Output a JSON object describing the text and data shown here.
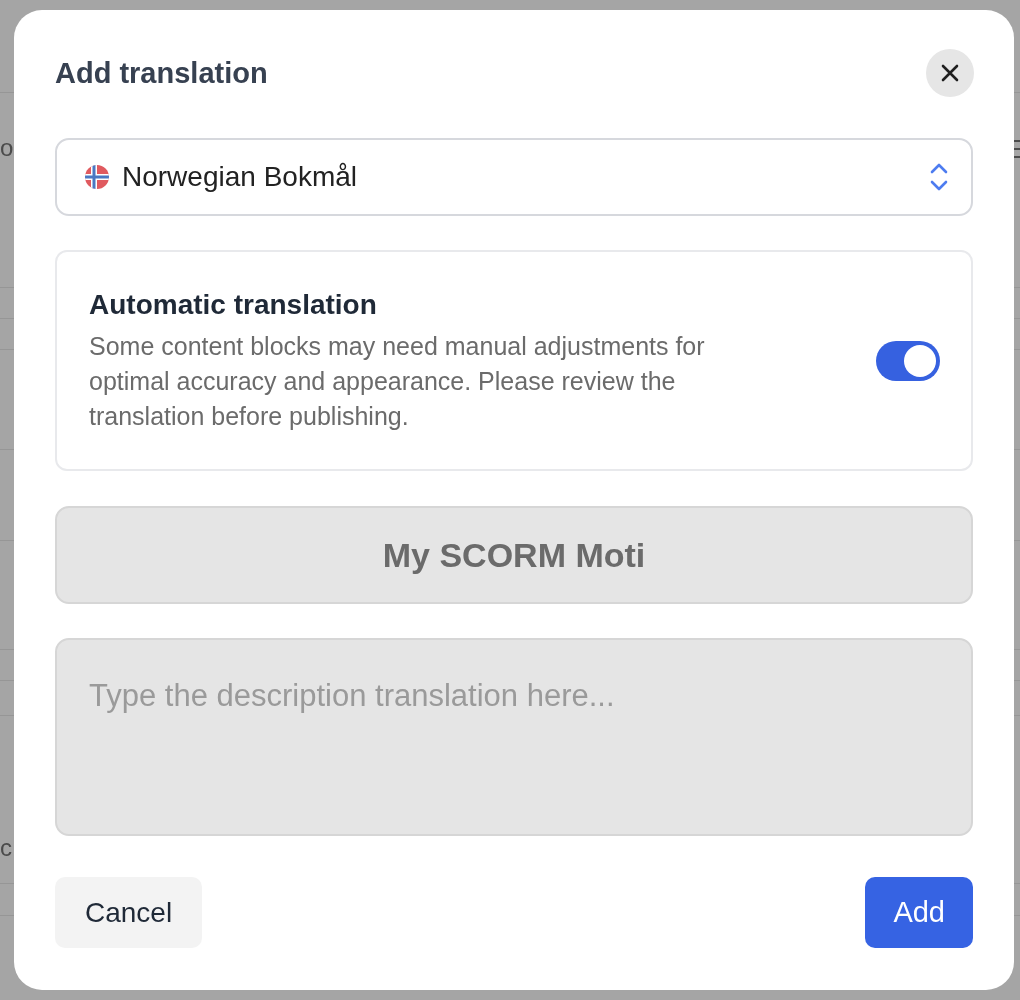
{
  "background_page": {
    "texts": [
      "o",
      "c"
    ]
  },
  "dialog": {
    "title": "Add translation",
    "language_select": {
      "value": "Norwegian Bokmål"
    },
    "auto_translation": {
      "title": "Automatic translation",
      "description": "Some content blocks may need manual adjustments for optimal accuracy and appearance. Please review the translation before publishing.",
      "on": true
    },
    "title_field": {
      "value": "My SCORM Moti",
      "disabled": true
    },
    "description_field": {
      "placeholder": "Type the description translation here...",
      "disabled": true
    },
    "buttons": [
      {
        "label": "Cancel",
        "kind": "secondary"
      },
      {
        "label": "Add",
        "kind": "primary"
      }
    ]
  }
}
